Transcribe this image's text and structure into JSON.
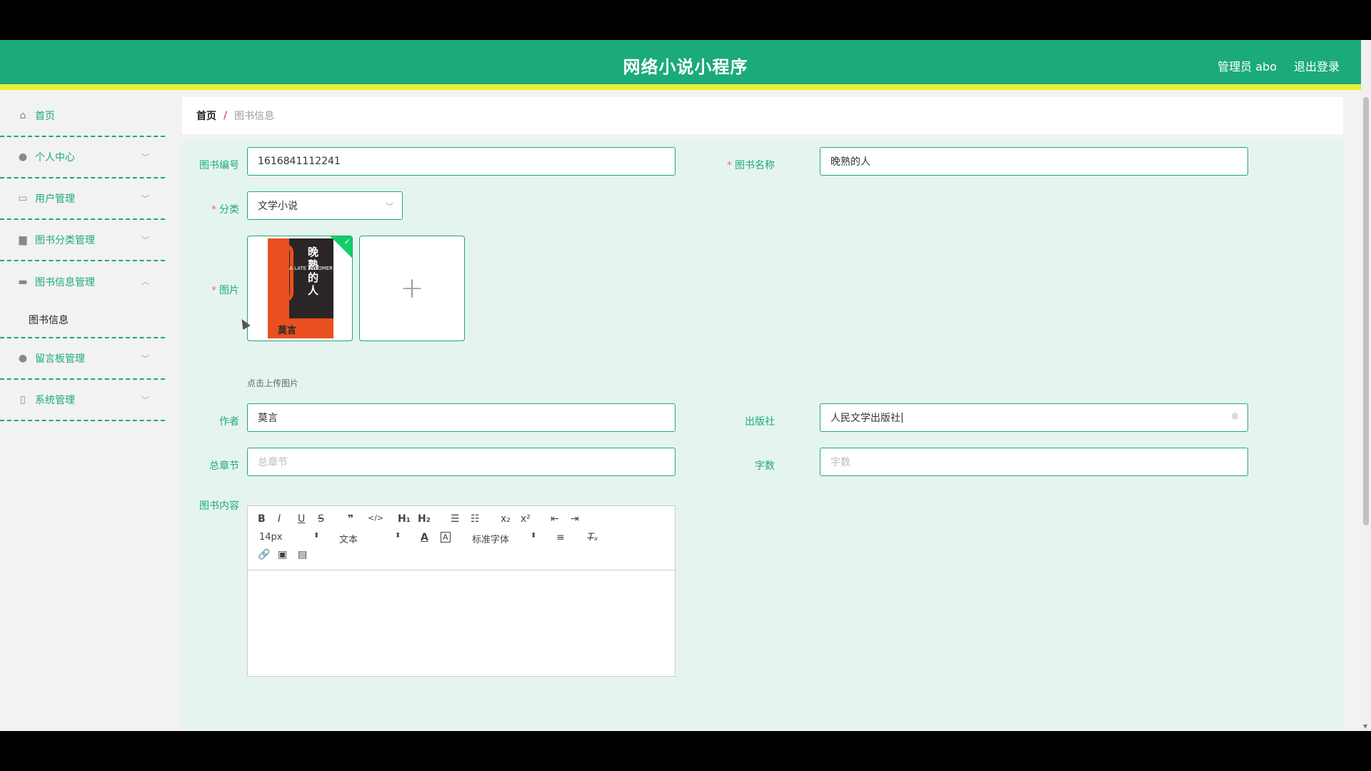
{
  "header": {
    "title": "网络小说小程序",
    "user": "管理员 abo",
    "logout": "退出登录"
  },
  "sidebar": {
    "items": [
      {
        "label": "首页",
        "icon": "home-icon"
      },
      {
        "label": "个人中心",
        "icon": "user-icon"
      },
      {
        "label": "用户管理",
        "icon": "chat-icon"
      },
      {
        "label": "图书分类管理",
        "icon": "book-icon"
      },
      {
        "label": "图书信息管理",
        "icon": "message-icon",
        "expanded": true,
        "sub": [
          "图书信息"
        ]
      },
      {
        "label": "留言板管理",
        "icon": "user-icon"
      },
      {
        "label": "系统管理",
        "icon": "phone-icon"
      }
    ]
  },
  "breadcrumb": {
    "home": "首页",
    "current": "图书信息"
  },
  "form": {
    "book_no_label": "图书编号",
    "book_no_value": "1616841112241",
    "book_name_label": "图书名称",
    "book_name_value": "晚熟的人",
    "category_label": "分类",
    "category_value": "文学小说",
    "image_label": "图片",
    "upload_hint": "点击上传图片",
    "author_label": "作者",
    "author_value": "莫言",
    "publisher_label": "出版社",
    "publisher_value": "人民文学出版社",
    "chapters_label": "总章节",
    "chapters_placeholder": "总章节",
    "words_label": "字数",
    "words_placeholder": "字数",
    "content_label": "图书内容"
  },
  "editor": {
    "font_size": "14px",
    "text_style": "文本",
    "font_family": "标准字体"
  },
  "book_cover": {
    "title": "晚熟的人",
    "english": "A LATE BLOOMER",
    "author": "莫言"
  }
}
